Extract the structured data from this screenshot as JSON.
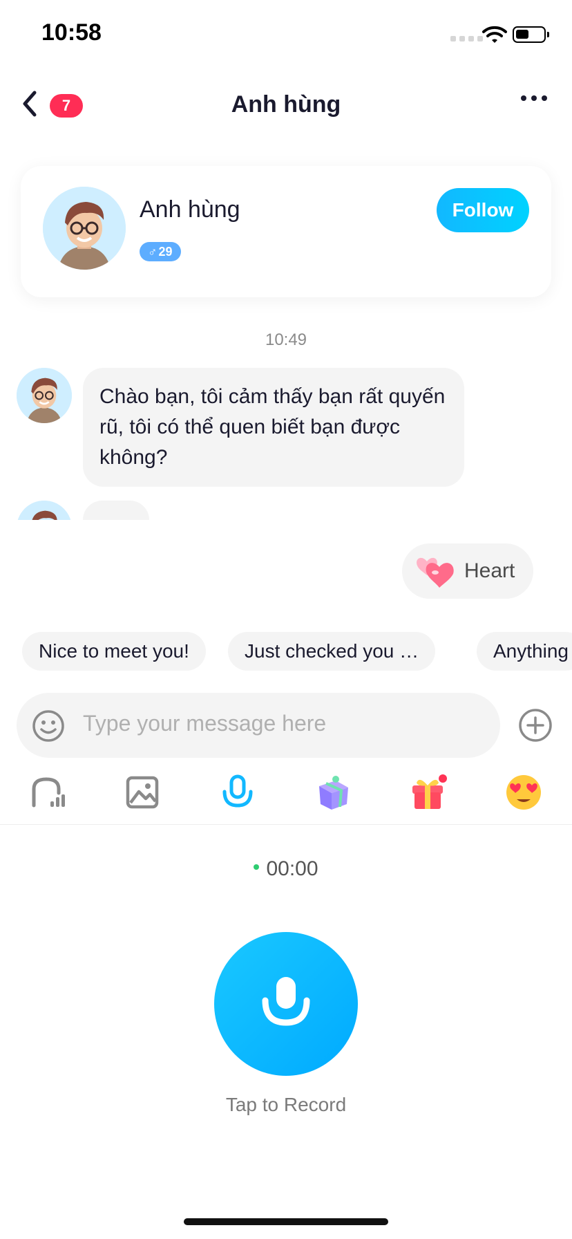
{
  "status_bar": {
    "time": "10:58"
  },
  "header": {
    "title": "Anh hùng",
    "unread_count": "7"
  },
  "profile": {
    "name": "Anh hùng",
    "age": "29",
    "follow_label": "Follow"
  },
  "chat": {
    "timestamp": "10:49",
    "messages": [
      {
        "text": "Chào bạn, tôi cảm thấy bạn rất quyến rũ, tôi có thể quen biết bạn được không?"
      }
    ],
    "heart_suggestion": "Heart"
  },
  "quick_replies": [
    "Nice to meet you!",
    "Just checked you …",
    "Anything"
  ],
  "input": {
    "placeholder": "Type your message here"
  },
  "toolbar": {
    "icons": [
      "signal-icon",
      "image-icon",
      "microphone-icon",
      "gift-box-icon",
      "gift-icon",
      "heart-eyes-emoji-icon"
    ],
    "accent": "#12b8ff"
  },
  "recorder": {
    "timer": "00:00",
    "label": "Tap to Record"
  }
}
